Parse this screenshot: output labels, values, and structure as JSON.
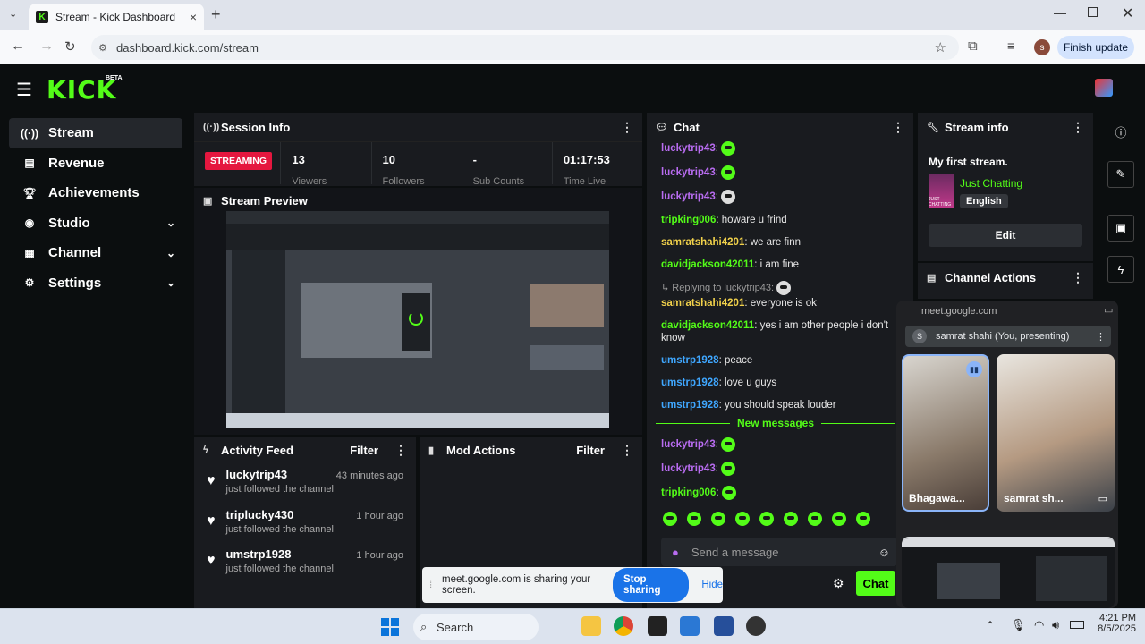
{
  "browser": {
    "tab_title": "Stream - Kick Dashboard",
    "url": "dashboard.kick.com/stream",
    "finish_update": "Finish update",
    "profile_initial": "s"
  },
  "app": {
    "logo": "KICK",
    "beta": "BETA"
  },
  "sidebar": {
    "items": [
      {
        "label": "Stream",
        "icon": "stream-icon"
      },
      {
        "label": "Revenue",
        "icon": "revenue-icon"
      },
      {
        "label": "Achievements",
        "icon": "trophy-icon"
      },
      {
        "label": "Studio",
        "icon": "studio-icon"
      },
      {
        "label": "Channel",
        "icon": "channel-icon"
      },
      {
        "label": "Settings",
        "icon": "gear-icon"
      }
    ]
  },
  "session": {
    "title": "Session Info",
    "status": "STREAMING",
    "viewers": "13",
    "viewers_label": "Viewers",
    "followers": "10",
    "followers_label": "Followers",
    "subs": "-",
    "subs_label": "Sub Counts",
    "time": "01:17:53",
    "time_label": "Time Live"
  },
  "preview": {
    "title": "Stream Preview"
  },
  "activity": {
    "title": "Activity Feed",
    "filter": "Filter",
    "items": [
      {
        "name": "luckytrip43",
        "sub": "just followed the channel",
        "time": "43 minutes ago"
      },
      {
        "name": "triplucky430",
        "sub": "just followed the channel",
        "time": "1 hour ago"
      },
      {
        "name": "umstrp1928",
        "sub": "just followed the channel",
        "time": "1 hour ago"
      }
    ]
  },
  "mod": {
    "title": "Mod Actions",
    "filter": "Filter"
  },
  "chat": {
    "title": "Chat",
    "lines": [
      {
        "user": "luckytrip43",
        "color": "#b86cf0",
        "text": "",
        "emote": true
      },
      {
        "user": "luckytrip43",
        "color": "#b86cf0",
        "text": "",
        "emote": true
      },
      {
        "user": "luckytrip43",
        "color": "#b86cf0",
        "text": "",
        "emote": true
      },
      {
        "user": "tripking006",
        "color": "#53fc18",
        "text": "howare u frind",
        "emote": false
      },
      {
        "user": "samratshahi4201",
        "color": "#f2d24b",
        "text": "we are finn",
        "emote": false
      },
      {
        "user": "davidjackson42011",
        "color": "#53fc18",
        "text": "i am fine",
        "emote": false
      }
    ],
    "reply_hint": "Replying to luckytrip43:",
    "lines2": [
      {
        "user": "samratshahi4201",
        "color": "#f2d24b",
        "text": "everyone is ok"
      },
      {
        "user": "davidjackson42011",
        "color": "#53fc18",
        "text": "yes i am other people i don't know"
      },
      {
        "user": "umstrp1928",
        "color": "#3fa7ff",
        "text": "peace"
      },
      {
        "user": "umstrp1928",
        "color": "#3fa7ff",
        "text": "love u guys"
      },
      {
        "user": "umstrp1928",
        "color": "#3fa7ff",
        "text": "you should speak louder"
      }
    ],
    "new_messages": "New messages",
    "lines3": [
      {
        "user": "luckytrip43",
        "color": "#b86cf0"
      },
      {
        "user": "luckytrip43",
        "color": "#b86cf0"
      },
      {
        "user": "tripking006",
        "color": "#53fc18"
      }
    ],
    "placeholder": "Send a message",
    "send": "Chat"
  },
  "stream_info": {
    "title": "Stream info",
    "stream_title": "My first stream.",
    "category": "Just Chatting",
    "language": "English",
    "edit": "Edit",
    "thumb_label": "JUST CHATTING"
  },
  "channel_actions": {
    "title": "Channel Actions"
  },
  "meet": {
    "domain": "meet.google.com",
    "presenter_initial": "S",
    "presenter": "samrat shahi (You, presenting)",
    "tile1": "Bhagawa...",
    "tile2": "samrat sh..."
  },
  "sharebar": {
    "text": "meet.google.com is sharing your screen.",
    "stop": "Stop sharing",
    "hide": "Hide"
  },
  "taskbar": {
    "search": "Search",
    "time": "4:21 PM",
    "date": "8/5/2025"
  }
}
